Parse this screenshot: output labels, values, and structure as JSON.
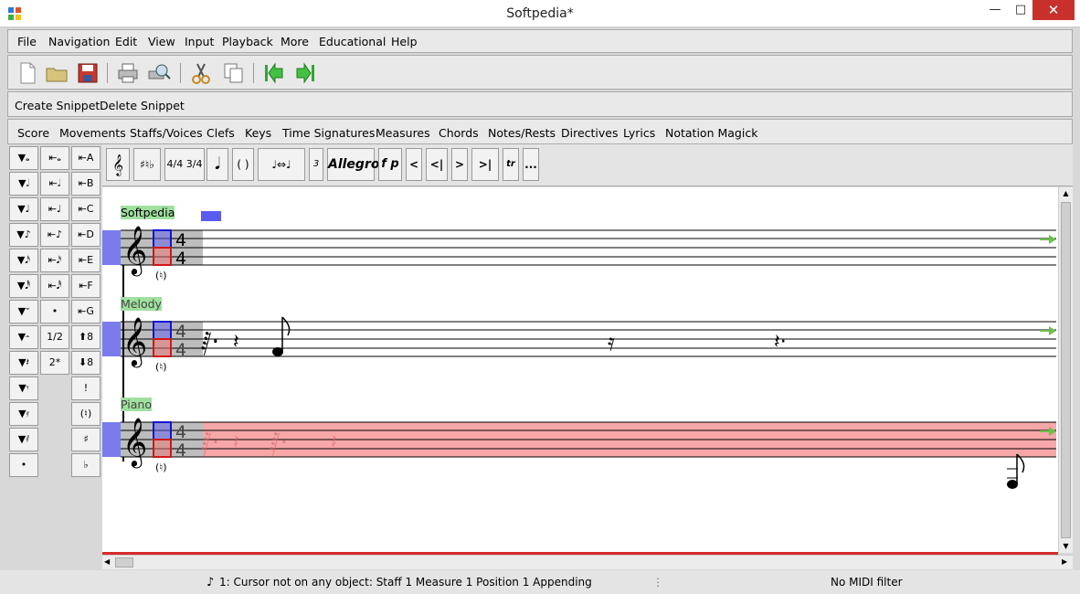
{
  "window": {
    "title": "Softpedia*"
  },
  "window_controls": {
    "minimize": "—",
    "maximize": "□",
    "close": "✕"
  },
  "menu": [
    "File",
    "Navigation",
    "Edit",
    "View",
    "Input",
    "Playback",
    "More",
    "Educational",
    "Help"
  ],
  "toolbar_icons": [
    "new-file",
    "open-folder",
    "save",
    "print",
    "print-preview",
    "cut",
    "copy",
    "previous-movement",
    "next-movement"
  ],
  "snippets": {
    "create": "Create Snippet",
    "delete": "Delete Snippet"
  },
  "categories": [
    "Score",
    "Movements",
    "Staffs/Voices",
    "Clefs",
    "Keys",
    "Time Signatures",
    "Measures",
    "Chords",
    "Notes/Rests",
    "Directives",
    "Lyrics",
    "Notation Magick"
  ],
  "palette": {
    "col1": [
      "▼𝅝",
      "▼𝅗𝅥",
      "▼♩",
      "▼♪",
      "▼𝅘𝅥𝅯",
      "▼𝅘𝅥𝅰",
      "▼𝄻",
      "▼𝄼",
      "▼𝄽",
      "▼𝄾",
      "▼𝄿",
      "▼𝅀",
      "•"
    ],
    "col2": [
      "⇤𝅝",
      "⇤𝅗𝅥",
      "⇤♩",
      "⇤♪",
      "⇤𝅘𝅥𝅯",
      "⇤𝅘𝅥𝅰",
      "•",
      "1/2",
      "2*"
    ],
    "col3": [
      "⇤A",
      "⇤B",
      "⇤C",
      "⇤D",
      "⇤E",
      "⇤F",
      "⇤G",
      "⬆8",
      "⬇8",
      "!",
      "(♮)",
      "♯",
      "♭"
    ]
  },
  "symbols": [
    "𝄞",
    "♯♮♭",
    "4/4 3/4",
    "𝅘𝅥",
    "(  )",
    "♩⇔♩",
    "3",
    "Allegro",
    "f p",
    "<",
    "<|",
    ">",
    ">|",
    "tr",
    "..."
  ],
  "staves": [
    {
      "name": "Softpedia",
      "time_top": "4",
      "time_bottom": "4"
    },
    {
      "name": "Melody",
      "time_top": "4",
      "time_bottom": "4"
    },
    {
      "name": "Piano",
      "time_top": "4",
      "time_bottom": "4"
    }
  ],
  "status": {
    "cursor": "1: Cursor not on any object:  Staff 1 Measure 1 Position 1 Appending",
    "midi": "No MIDI filter"
  }
}
